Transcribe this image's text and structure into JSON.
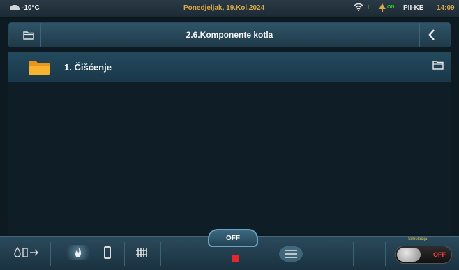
{
  "status_bar": {
    "temperature": "-10°C",
    "date": "Ponedjeljak, 19.Kol.2024",
    "signal_indicator": "!!",
    "on_badge": "ON",
    "model": "PII-KE",
    "time": "14:09"
  },
  "header": {
    "title": "2.6.Komponente kotla"
  },
  "list": {
    "items": [
      {
        "number": "1.",
        "label": "1. Čišćenje"
      }
    ]
  },
  "bottom_bar": {
    "off_label": "OFF",
    "simulation_label": "Simulacija",
    "simulation_state": "OFF"
  },
  "colors": {
    "accent_yellow": "#d8a94a",
    "folder_yellow": "#f5a623",
    "alert_red": "#e5262a",
    "on_green": "#2ec82a"
  },
  "icons": {
    "status": [
      "cloud-icon",
      "wifi-icon",
      "tree-icon"
    ],
    "header": [
      "folder-icon",
      "back-chevron-icon"
    ],
    "list": [
      "yellow-folder-icon",
      "open-folder-icon"
    ],
    "bottom": [
      "water-flame-icon",
      "flame-icon",
      "single-column-icon",
      "radiator-icon",
      "stop-icon",
      "menu-icon",
      "toggle-switch-icon"
    ]
  }
}
